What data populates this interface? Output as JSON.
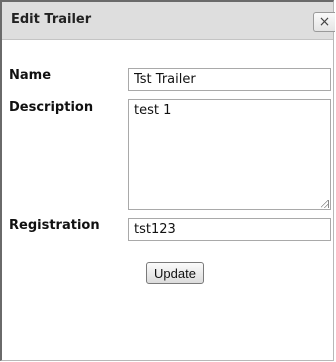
{
  "dialog": {
    "title": "Edit Trailer",
    "close_label": "×"
  },
  "form": {
    "name_label": "Name",
    "name_value": "Tst Trailer",
    "description_label": "Description",
    "description_value": "test 1",
    "registration_label": "Registration",
    "registration_value": "tst123",
    "update_label": "Update"
  }
}
